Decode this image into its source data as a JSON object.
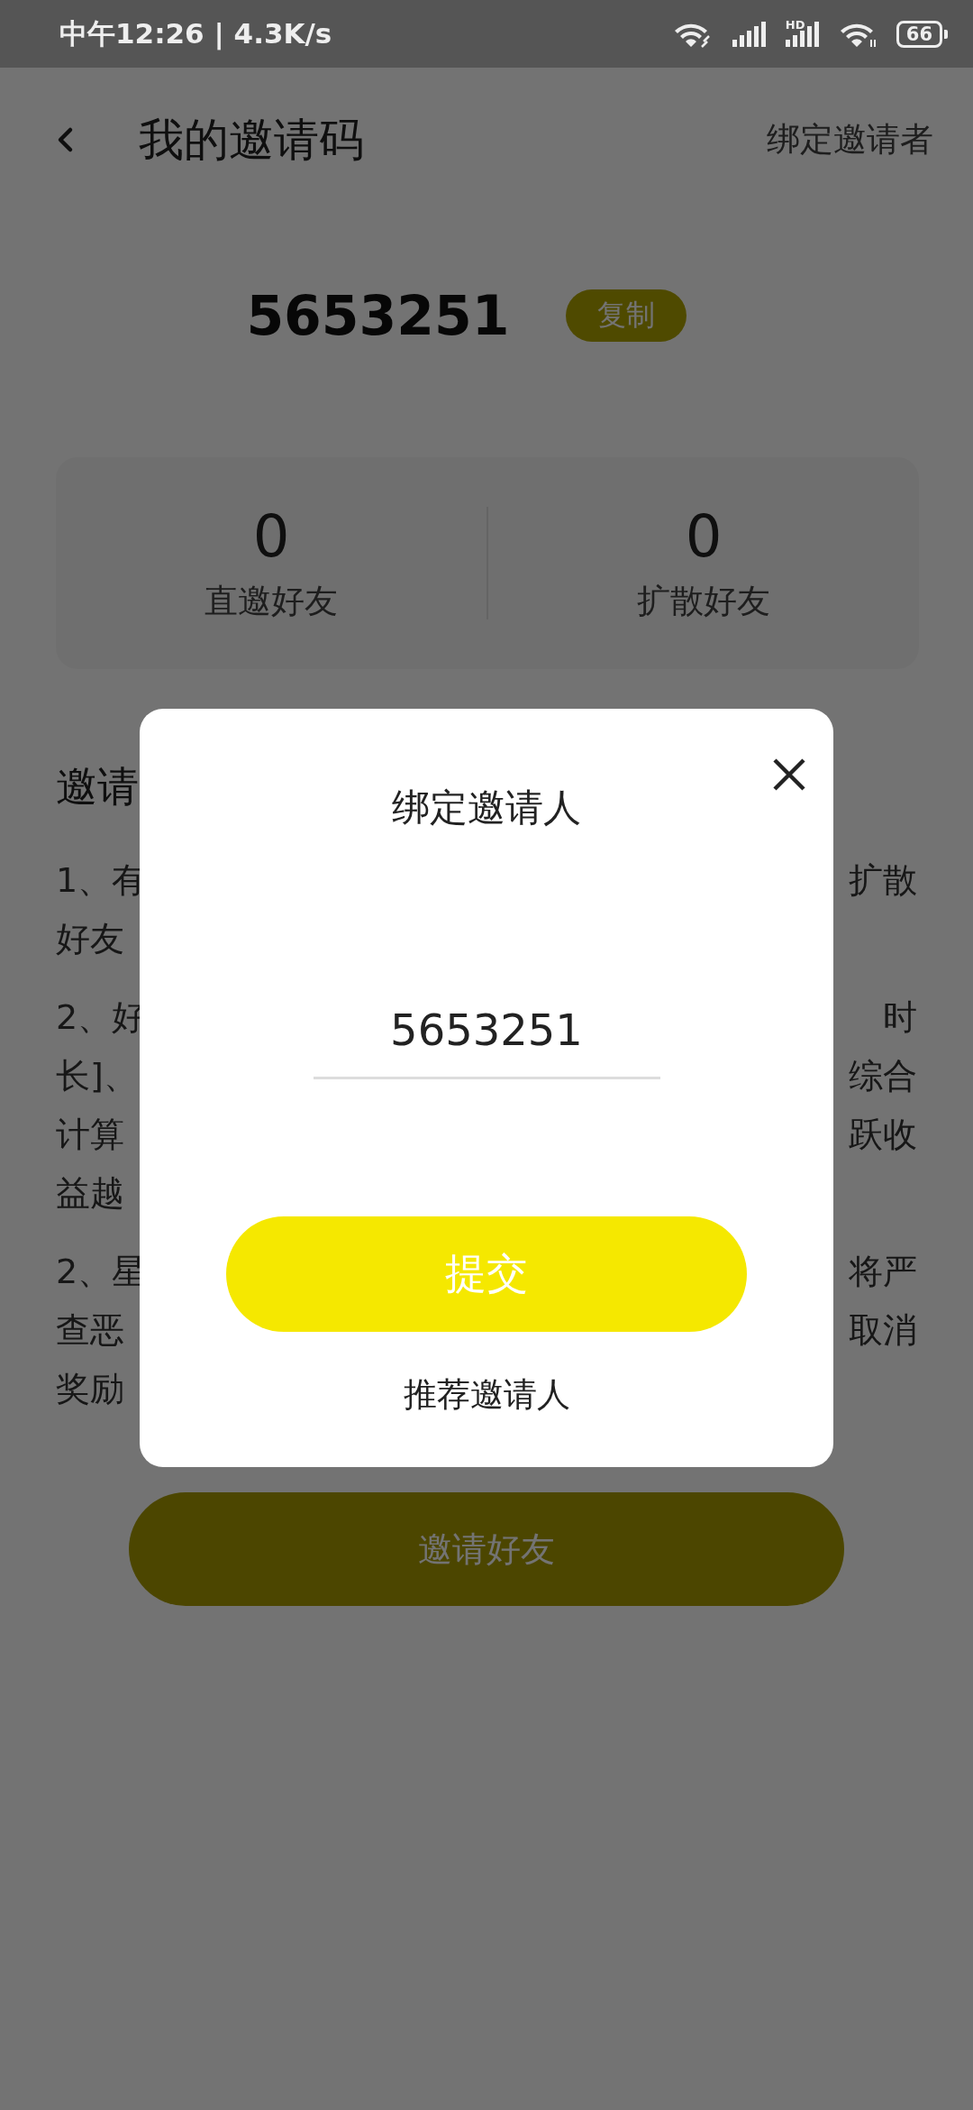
{
  "status_bar": {
    "time": "中午12:26 | 4.3K/s",
    "network_label": "HD",
    "battery": "66"
  },
  "header": {
    "title": "我的邀请码",
    "action": "绑定邀请者"
  },
  "invite_code": {
    "code": "5653251",
    "copy_label": "复制"
  },
  "stats": [
    {
      "value": "0",
      "label": "直邀好友"
    },
    {
      "value": "0",
      "label": "扩散好友"
    }
  ],
  "rules": {
    "title": "邀请",
    "paragraphs": [
      {
        "lines": [
          {
            "left": "1、有",
            "right": "扩散"
          },
          {
            "left": "好友"
          }
        ]
      },
      {
        "lines": [
          {
            "left": "2、好",
            "right": "时"
          },
          {
            "left": "长]、",
            "right": "综合"
          },
          {
            "left": "计算",
            "right": "跃收"
          },
          {
            "left": "益越"
          }
        ]
      },
      {
        "lines": [
          {
            "left": "2、星",
            "right": "将严"
          },
          {
            "left": "查恶",
            "right": "取消"
          },
          {
            "left": "奖励"
          }
        ]
      }
    ]
  },
  "invite_button": "邀请好友",
  "dialog": {
    "title": "绑定邀请人",
    "value": "5653251",
    "submit": "提交",
    "link": "推荐邀请人"
  }
}
